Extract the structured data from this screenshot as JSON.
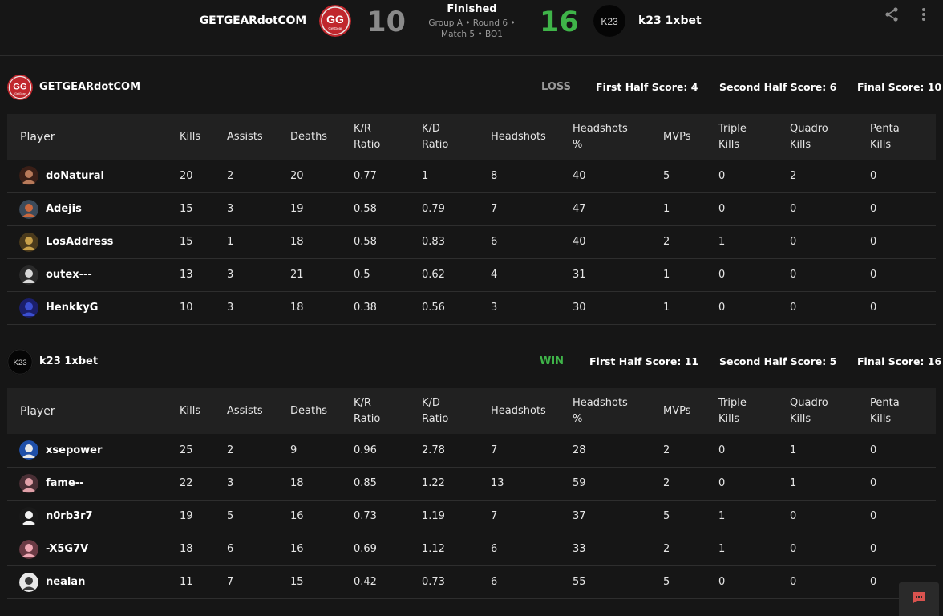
{
  "header": {
    "team_left": "GETGEARdotCOM",
    "team_right": "k23 1xbet",
    "score_left": "10",
    "score_right": "16",
    "status": "Finished",
    "details_line1": "Group A • Round 6 •",
    "details_line2": "Match 5 • BO1",
    "share_icon": "share-icon",
    "more_icon": "more-vertical-icon"
  },
  "colors": {
    "background": "#161616",
    "win": "#3fb449",
    "loss": "#9a9a9a",
    "gg_logo": "#c0272d"
  },
  "columns": [
    "Player",
    "Kills",
    "Assists",
    "Deaths",
    "K/R Ratio",
    "K/D Ratio",
    "Headshots",
    "Headshots %",
    "MVPs",
    "Triple Kills",
    "Quadro Kills",
    "Penta Kills"
  ],
  "teams": [
    {
      "name": "GETGEARdotCOM",
      "result": "LOSS",
      "first_half": "First Half Score: 4",
      "second_half": "Second Half Score: 6",
      "final": "Final Score: 10",
      "players": [
        {
          "name": "doNatural",
          "stats": [
            "20",
            "2",
            "20",
            "0.77",
            "1",
            "8",
            "40",
            "5",
            "0",
            "2",
            "0"
          ]
        },
        {
          "name": "Adejis",
          "stats": [
            "15",
            "3",
            "19",
            "0.58",
            "0.79",
            "7",
            "47",
            "1",
            "0",
            "0",
            "0"
          ]
        },
        {
          "name": "LosAddress",
          "stats": [
            "15",
            "1",
            "18",
            "0.58",
            "0.83",
            "6",
            "40",
            "2",
            "1",
            "0",
            "0"
          ]
        },
        {
          "name": "outex---",
          "stats": [
            "13",
            "3",
            "21",
            "0.5",
            "0.62",
            "4",
            "31",
            "1",
            "0",
            "0",
            "0"
          ]
        },
        {
          "name": "HenkkyG",
          "stats": [
            "10",
            "3",
            "18",
            "0.38",
            "0.56",
            "3",
            "30",
            "1",
            "0",
            "0",
            "0"
          ]
        }
      ]
    },
    {
      "name": "k23 1xbet",
      "result": "WIN",
      "first_half": "First Half Score: 11",
      "second_half": "Second Half Score: 5",
      "final": "Final Score: 16",
      "players": [
        {
          "name": "xsepower",
          "stats": [
            "25",
            "2",
            "9",
            "0.96",
            "2.78",
            "7",
            "28",
            "2",
            "0",
            "1",
            "0"
          ]
        },
        {
          "name": "fame--",
          "stats": [
            "22",
            "3",
            "18",
            "0.85",
            "1.22",
            "13",
            "59",
            "2",
            "0",
            "1",
            "0"
          ]
        },
        {
          "name": "n0rb3r7",
          "stats": [
            "19",
            "5",
            "16",
            "0.73",
            "1.19",
            "7",
            "37",
            "5",
            "1",
            "0",
            "0"
          ]
        },
        {
          "name": "-X5G7V",
          "stats": [
            "18",
            "6",
            "16",
            "0.69",
            "1.12",
            "6",
            "33",
            "2",
            "1",
            "0",
            "0"
          ]
        },
        {
          "name": "nealan",
          "stats": [
            "11",
            "7",
            "15",
            "0.42",
            "0.73",
            "6",
            "55",
            "5",
            "0",
            "0",
            "0"
          ]
        }
      ]
    }
  ],
  "logos": {
    "gg_text": "GG",
    "gg_sub": "GetGear",
    "k23_text": "K23"
  },
  "chat_icon": "chat-icon"
}
